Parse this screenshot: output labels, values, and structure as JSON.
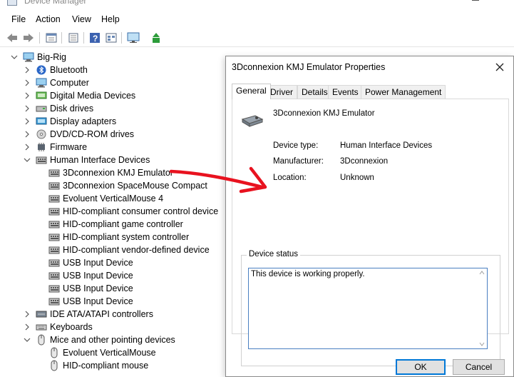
{
  "window": {
    "title": "Device Manager"
  },
  "menu": [
    "File",
    "Action",
    "View",
    "Help"
  ],
  "toolbar": [
    "back-icon",
    "forward-icon",
    "show-hide-icon",
    "properties-icon",
    "help-icon",
    "view-icon",
    "monitor-icon",
    "update-driver-icon"
  ],
  "tree": [
    {
      "label": "Big-Rig",
      "level": 0,
      "expanded": true,
      "icon": "computer-icon"
    },
    {
      "label": "Bluetooth",
      "level": 1,
      "expanded": false,
      "icon": "bluetooth-icon"
    },
    {
      "label": "Computer",
      "level": 1,
      "expanded": false,
      "icon": "computer-icon"
    },
    {
      "label": "Digital Media Devices",
      "level": 1,
      "expanded": false,
      "icon": "media-icon"
    },
    {
      "label": "Disk drives",
      "level": 1,
      "expanded": false,
      "icon": "disk-icon"
    },
    {
      "label": "Display adapters",
      "level": 1,
      "expanded": false,
      "icon": "display-icon"
    },
    {
      "label": "DVD/CD-ROM drives",
      "level": 1,
      "expanded": false,
      "icon": "dvd-icon"
    },
    {
      "label": "Firmware",
      "level": 1,
      "expanded": false,
      "icon": "chip-icon"
    },
    {
      "label": "Human Interface Devices",
      "level": 1,
      "expanded": true,
      "icon": "hid-icon"
    },
    {
      "label": "3Dconnexion KMJ Emulator",
      "level": 2,
      "icon": "hid-icon"
    },
    {
      "label": "3Dconnexion SpaceMouse Compact",
      "level": 2,
      "icon": "hid-icon"
    },
    {
      "label": "Evoluent VerticalMouse 4",
      "level": 2,
      "icon": "hid-icon"
    },
    {
      "label": "HID-compliant consumer control device",
      "level": 2,
      "icon": "hid-icon"
    },
    {
      "label": "HID-compliant game controller",
      "level": 2,
      "icon": "hid-icon"
    },
    {
      "label": "HID-compliant system controller",
      "level": 2,
      "icon": "hid-icon"
    },
    {
      "label": "HID-compliant vendor-defined device",
      "level": 2,
      "icon": "hid-icon"
    },
    {
      "label": "USB Input Device",
      "level": 2,
      "icon": "hid-icon"
    },
    {
      "label": "USB Input Device",
      "level": 2,
      "icon": "hid-icon"
    },
    {
      "label": "USB Input Device",
      "level": 2,
      "icon": "hid-icon"
    },
    {
      "label": "USB Input Device",
      "level": 2,
      "icon": "hid-icon"
    },
    {
      "label": "IDE ATA/ATAPI controllers",
      "level": 1,
      "expanded": false,
      "icon": "ide-icon"
    },
    {
      "label": "Keyboards",
      "level": 1,
      "expanded": false,
      "icon": "keyboard-icon"
    },
    {
      "label": "Mice and other pointing devices",
      "level": 1,
      "expanded": true,
      "icon": "mouse-icon"
    },
    {
      "label": "Evoluent VerticalMouse",
      "level": 2,
      "icon": "mouse-icon"
    },
    {
      "label": "HID-compliant mouse",
      "level": 2,
      "icon": "mouse-icon"
    }
  ],
  "dialog": {
    "title": "3Dconnexion KMJ Emulator Properties",
    "tabs": [
      "General",
      "Driver",
      "Details",
      "Events",
      "Power Management"
    ],
    "active_tab": "General",
    "device_name": "3Dconnexion KMJ Emulator",
    "device_type_label": "Device type:",
    "device_type": "Human Interface Devices",
    "manufacturer_label": "Manufacturer:",
    "manufacturer": "3Dconnexion",
    "location_label": "Location:",
    "location": "Unknown",
    "status_group": "Device status",
    "status_text": "This device is working properly.",
    "ok": "OK",
    "cancel": "Cancel"
  },
  "colors": {
    "annotation_arrow": "#e8121f",
    "focus_border": "#0078d7"
  }
}
